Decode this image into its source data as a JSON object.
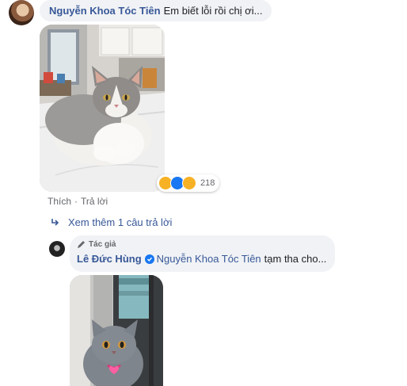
{
  "comment": {
    "author": "Nguyễn Khoa Tóc Tiên",
    "text": "Em biết lỗi rồi chị ơi...",
    "reactions": {
      "icons": [
        "haha-icon",
        "like-icon",
        "sad-icon"
      ],
      "count": "218"
    },
    "actions": {
      "like": "Thích",
      "separator": "·",
      "reply": "Trả lời"
    }
  },
  "view_more": {
    "label": "Xem thêm 1 câu trả lời"
  },
  "reply": {
    "badge": "Tác giả",
    "author": "Lê Đức Hùng",
    "mention": "Nguyễn Khoa Tóc Tiên",
    "text": "tạm tha cho..."
  },
  "colors": {
    "link": "#385898",
    "bubble": "#f0f2f5",
    "meta": "#65676b",
    "verified": "#1877f2"
  }
}
